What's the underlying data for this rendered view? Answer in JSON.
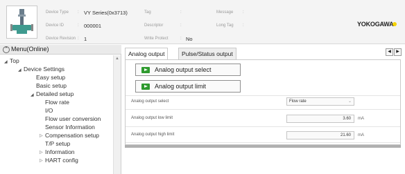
{
  "header": {
    "fields": [
      {
        "label": "Device Type",
        "value": "VY Series(0x3713)"
      },
      {
        "label": "Device ID",
        "value": "000001"
      },
      {
        "label": "Device Revision",
        "value": "1"
      },
      {
        "label": "Tag",
        "value": ""
      },
      {
        "label": "Descriptor",
        "value": ""
      },
      {
        "label": "Write Protect",
        "value": "No"
      },
      {
        "label": "Message",
        "value": ""
      },
      {
        "label": "Long Tag",
        "value": ""
      }
    ],
    "brand": "YOKOGAWA",
    "brand_accent_color": "#f5d300",
    "device_image_icon": "flowmeter-device-image"
  },
  "tree": {
    "title": "Menu(Online)",
    "collapse_icon": "circle-chevron-up-icon",
    "items": [
      {
        "label": "Top"
      },
      {
        "label": "Device Settings"
      },
      {
        "label": "Easy setup"
      },
      {
        "label": "Basic setup"
      },
      {
        "label": "Detailed setup"
      },
      {
        "label": "Flow rate"
      },
      {
        "label": "I/O"
      },
      {
        "label": "Flow user conversion"
      },
      {
        "label": "Sensor Information"
      },
      {
        "label": "Compensation setup"
      },
      {
        "label": "T/P setup"
      },
      {
        "label": "Information"
      },
      {
        "label": "HART config"
      }
    ]
  },
  "tabs": [
    {
      "label": "Analog output",
      "active": true
    },
    {
      "label": "Pulse/Status output",
      "active": false
    }
  ],
  "buttons": [
    {
      "label": "Analog output select",
      "icon": "play-icon"
    },
    {
      "label": "Analog output limit",
      "icon": "play-icon"
    }
  ],
  "params": [
    {
      "label": "Analog output select",
      "value": "Flow rate",
      "unit": ""
    },
    {
      "label": "Analog output low limit",
      "value": "3.60",
      "unit": "mA"
    },
    {
      "label": "Analog output high limit",
      "value": "21.60",
      "unit": "mA"
    }
  ],
  "colors": {
    "play_icon": "#2e9a2e"
  }
}
